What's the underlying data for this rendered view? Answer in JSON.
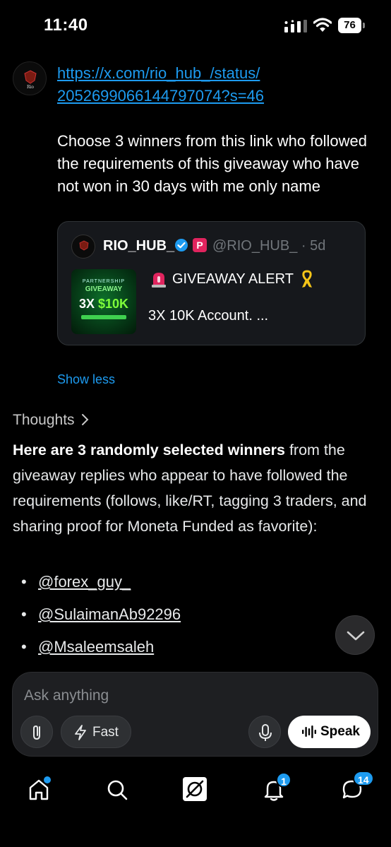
{
  "status_bar": {
    "time": "11:40",
    "battery": "76"
  },
  "user_message": {
    "link": "https://x.com/rio_hub_/status/2052699066144797074?s=46",
    "link_line1": "https://x.com/rio_hub_/status/",
    "link_line2": "2052699066144797074?s=46",
    "text": "Choose 3 winners from this link who followed the requirements of this giveaway who have not won in 30 days with me only name"
  },
  "quote_card": {
    "name": "RIO_HUB_",
    "handle": "@RIO_HUB_ · 5d",
    "title": "GIVEAWAY ALERT",
    "description": "3X 10K Account. ...",
    "thumbnail": {
      "line1": "PARTNERSHIP",
      "line2": "GIVEAWAY",
      "line3a": "3X ",
      "line3b": "$10K"
    }
  },
  "show_less": "Show less",
  "thoughts_label": "Thoughts",
  "answer": {
    "bold": "Here are 3 randomly selected winners",
    "rest": " from the giveaway replies who appear to have followed the requirements (follows, like/RT, tagging 3 traders, and sharing proof for Moneta Funded as favorite):",
    "bullet": "•",
    "winners": [
      "@forex_guy_",
      "@SulaimanAb92296",
      "@Msaleemsaleh"
    ]
  },
  "composer": {
    "placeholder": "Ask anything",
    "fast_label": "Fast",
    "speak_label": "Speak"
  },
  "nav": {
    "notifications_count": "1",
    "messages_count": "14"
  },
  "colors": {
    "accent": "#1d9bf0",
    "background": "#000000",
    "badge_red": "#e0245e"
  },
  "icons": [
    "signal-icon",
    "wifi-icon",
    "battery-icon",
    "verified-icon",
    "alert-light-icon",
    "ribbon-icon",
    "chevron-right-icon",
    "chevron-down-icon",
    "paperclip-icon",
    "lightning-icon",
    "mic-icon",
    "waveform-icon",
    "home-icon",
    "search-icon",
    "grok-icon",
    "bell-icon",
    "chat-icon"
  ]
}
